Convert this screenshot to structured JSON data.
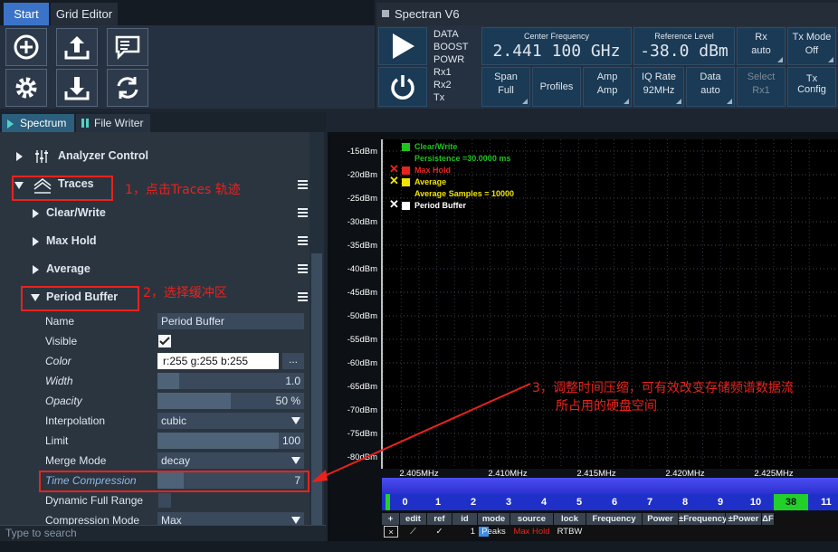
{
  "ribbon": {
    "tab_start": "Start",
    "tab_grid": "Grid Editor",
    "buttons": [
      "add-icon",
      "upload-icon",
      "comment-icon",
      "settings-icon",
      "download-icon",
      "sync-icon"
    ]
  },
  "spectran": {
    "title": "Spectran V6",
    "status": [
      "DATA",
      "BOOST",
      "POWR",
      "Rx1",
      "Rx2",
      "Tx"
    ],
    "center_frequency_label": "Center Frequency",
    "center_frequency_value": "2.441 100 GHz",
    "reference_level_label": "Reference Level",
    "reference_level_value": "-38.0 dBm",
    "rx_label": "Rx",
    "rx_value": "auto",
    "txmode_label": "Tx Mode",
    "txmode_value": "Off",
    "span_label": "Span",
    "span_value": "Full",
    "profiles_label": "Profiles",
    "amp1_label": "Amp",
    "amp1_value": "Amp",
    "iqrate_label": "IQ Rate",
    "iqrate_value": "92MHz",
    "data_label": "Data",
    "data_value": "auto",
    "select_label": "Select",
    "select_value": "Rx1",
    "txconfig_label": "Tx",
    "txconfig_value": "Config"
  },
  "dock": {
    "tab_spectrum": "Spectrum",
    "tab_filewriter": "File Writer",
    "search_placeholder": "Type to search"
  },
  "tree": {
    "analyzer_control": "Analyzer Control",
    "traces": "Traces",
    "clear_write": "Clear/Write",
    "max_hold": "Max Hold",
    "average": "Average",
    "period_buffer": "Period Buffer",
    "props": {
      "name_label": "Name",
      "name_value": "Period Buffer",
      "visible_label": "Visible",
      "color_label": "Color",
      "color_value": "r:255 g:255 b:255",
      "color_more": "...",
      "width_label": "Width",
      "width_value": "1.0",
      "opacity_label": "Opacity",
      "opacity_value": "50 %",
      "interp_label": "Interpolation",
      "interp_value": "cubic",
      "limit_label": "Limit",
      "limit_value": "100",
      "merge_label": "Merge Mode",
      "merge_value": "decay",
      "tc_label": "Time Compression",
      "tc_value": "7",
      "dfr_label": "Dynamic Full Range",
      "cm_label": "Compression Mode",
      "cm_value": "Max"
    },
    "width_fill": 0.15,
    "opacity_fill": 0.5,
    "limit_fill": 0.83,
    "tc_fill": 0.18
  },
  "annotations": {
    "note1": "1，点击Traces 轨迹",
    "note2": "2，选择缓冲区",
    "note3_line1": "3，调整时间压缩，可有效改变存储频谱数据流",
    "note3_line2": "所占用的硬盘空间"
  },
  "chart_data": {
    "type": "line",
    "y_ticks": [
      "-15dBm",
      "-20dBm",
      "-25dBm",
      "-30dBm",
      "-35dBm",
      "-40dBm",
      "-45dBm",
      "-50dBm",
      "-55dBm",
      "-60dBm",
      "-65dBm",
      "-70dBm",
      "-75dBm",
      "-80dBm"
    ],
    "x_ticks": [
      "2,405MHz",
      "2,410MHz",
      "2,415MHz",
      "2,420MHz",
      "2,425MHz"
    ],
    "grid": true,
    "legend": [
      {
        "name": "Clear/Write",
        "color": "#1fc21f",
        "sub": "Persistence  =30.0000 ms",
        "x": false
      },
      {
        "name": "Max Hold",
        "color": "#e8231d",
        "sub": "",
        "x": true
      },
      {
        "name": "Average",
        "color": "#f0e400",
        "sub": "Average Samples = 10000",
        "x": true
      },
      {
        "name": "Period Buffer",
        "color": "#ffffff",
        "sub": "",
        "x": true
      }
    ]
  },
  "channels": [
    "0",
    "1",
    "2",
    "3",
    "4",
    "5",
    "6",
    "7",
    "8",
    "9",
    "10",
    "38",
    "11"
  ],
  "markers": {
    "headers": [
      "+",
      "edit",
      "ref",
      "id",
      "mode",
      "source",
      "lock",
      "Frequency",
      "Power",
      "±Frequency",
      "±Power",
      "ΔF"
    ],
    "row": [
      "×",
      "⟋",
      "✓",
      "1",
      "Peaks",
      "Max Hold",
      "RTBW",
      "",
      "",
      "",
      "",
      ""
    ]
  }
}
